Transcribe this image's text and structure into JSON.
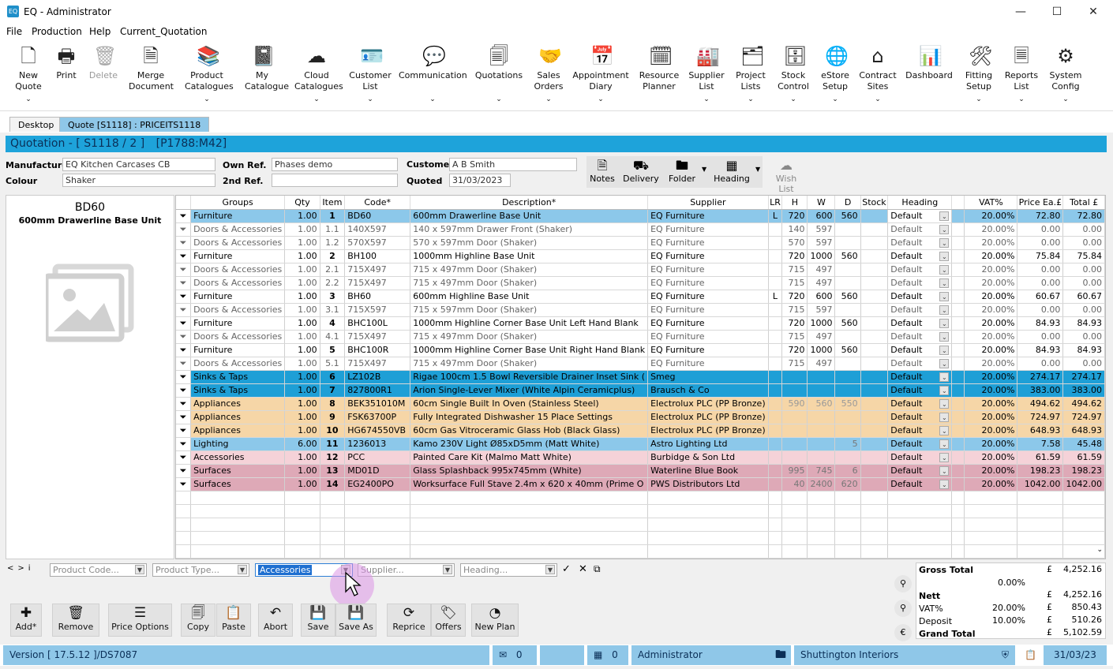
{
  "window": {
    "title": "EQ - Administrator",
    "icon_text": "EQ"
  },
  "menu": [
    "File",
    "Production",
    "Help",
    "Current_Quotation"
  ],
  "ribbon": [
    {
      "label1": "New",
      "label2": "Quote",
      "icon": "new-quote-icon",
      "chev": true,
      "disabled": false
    },
    {
      "label1": "Print",
      "label2": "",
      "icon": "print-icon",
      "chev": false,
      "disabled": false
    },
    {
      "label1": "Delete",
      "label2": "",
      "icon": "delete-icon",
      "chev": false,
      "disabled": true
    },
    {
      "label1": "Merge",
      "label2": "Document",
      "icon": "merge-document-icon",
      "chev": false,
      "disabled": false
    },
    {
      "label1": "Product",
      "label2": "Catalogues",
      "icon": "product-catalogues-icon",
      "chev": true,
      "disabled": false
    },
    {
      "label1": "My",
      "label2": "Catalogue",
      "icon": "my-catalogue-icon",
      "chev": false,
      "disabled": false
    },
    {
      "label1": "Cloud",
      "label2": "Catalogues",
      "icon": "cloud-catalogues-icon",
      "chev": true,
      "disabled": false
    },
    {
      "label1": "Customer",
      "label2": "List",
      "icon": "customer-list-icon",
      "chev": true,
      "disabled": false
    },
    {
      "label1": "Communication",
      "label2": "",
      "icon": "communication-icon",
      "chev": true,
      "disabled": false
    },
    {
      "label1": "Quotations",
      "label2": "",
      "icon": "quotations-icon",
      "chev": true,
      "disabled": false
    },
    {
      "label1": "Sales",
      "label2": "Orders",
      "icon": "sales-orders-icon",
      "chev": true,
      "disabled": false
    },
    {
      "label1": "Appointment",
      "label2": "Diary",
      "icon": "appointment-diary-icon",
      "chev": true,
      "disabled": false
    },
    {
      "label1": "Resource",
      "label2": "Planner",
      "icon": "resource-planner-icon",
      "chev": false,
      "disabled": false
    },
    {
      "label1": "Supplier",
      "label2": "List",
      "icon": "supplier-list-icon",
      "chev": true,
      "disabled": false
    },
    {
      "label1": "Project",
      "label2": "Lists",
      "icon": "project-lists-icon",
      "chev": true,
      "disabled": false
    },
    {
      "label1": "Stock",
      "label2": "Control",
      "icon": "stock-control-icon",
      "chev": true,
      "disabled": false
    },
    {
      "label1": "eStore",
      "label2": "Setup",
      "icon": "estore-setup-icon",
      "chev": true,
      "disabled": false
    },
    {
      "label1": "Contract",
      "label2": "Sites",
      "icon": "contract-sites-icon",
      "chev": true,
      "disabled": false
    },
    {
      "label1": "Dashboard",
      "label2": "",
      "icon": "dashboard-icon",
      "chev": false,
      "disabled": false
    },
    {
      "label1": "Fitting",
      "label2": "Setup",
      "icon": "fitting-setup-icon",
      "chev": true,
      "disabled": false
    },
    {
      "label1": "Reports",
      "label2": "List",
      "icon": "reports-list-icon",
      "chev": true,
      "disabled": false
    },
    {
      "label1": "System",
      "label2": "Config",
      "icon": "system-config-icon",
      "chev": true,
      "disabled": false
    }
  ],
  "tabs": {
    "desktop": "Desktop",
    "quote": "Quote [S1118] : PRICEITS1118"
  },
  "quote_bar": {
    "title": "Quotation - [ S1118 / 2 ]",
    "ref": "[P1788:M42]"
  },
  "header": {
    "manufacturer_label": "Manufacturer",
    "manufacturer": "EQ Kitchen Carcases CB",
    "colour_label": "Colour",
    "colour": "Shaker",
    "own_ref_label": "Own Ref.",
    "own_ref": "Phases demo",
    "second_ref_label": "2nd Ref.",
    "second_ref": "",
    "customer_label": "Customer",
    "customer": "A B Smith",
    "quoted_label": "Quoted",
    "quoted": "31/03/2023"
  },
  "toolbar": {
    "notes": "Notes",
    "delivery": "Delivery",
    "folder": "Folder",
    "heading": "Heading",
    "wish_list": "Wish List"
  },
  "preview": {
    "code": "BD60",
    "name": "600mm Drawerline Base Unit"
  },
  "columns": [
    "Groups",
    "Qty",
    "Item",
    "Code*",
    "Description*",
    "Supplier",
    "LR",
    "H",
    "W",
    "D",
    "Stock",
    "Heading",
    "VAT%",
    "Price Ea.£",
    "Total £"
  ],
  "rows": [
    {
      "group": "Furniture",
      "qty": "1.00",
      "item": "1",
      "code": "BD60",
      "desc": "600mm Drawerline Base Unit",
      "supplier": "EQ Furniture",
      "lr": "L",
      "h": "720",
      "w": "600",
      "d": "560",
      "heading": "Default",
      "vat": "20.00%",
      "price": "72.80",
      "total": "72.80",
      "style": "sel"
    },
    {
      "group": "Doors & Accessories",
      "qty": "1.00",
      "item": "1.1",
      "code": "140X597",
      "desc": "140 x 597mm Drawer Front (Shaker)",
      "supplier": "EQ Furniture",
      "lr": "",
      "h": "140",
      "w": "597",
      "d": "",
      "heading": "Default",
      "vat": "20.00%",
      "price": "0.00",
      "total": "0.00",
      "style": "sub"
    },
    {
      "group": "Doors & Accessories",
      "qty": "1.00",
      "item": "1.2",
      "code": "570X597",
      "desc": "570 x 597mm Door (Shaker)",
      "supplier": "EQ Furniture",
      "lr": "",
      "h": "570",
      "w": "597",
      "d": "",
      "heading": "Default",
      "vat": "20.00%",
      "price": "0.00",
      "total": "0.00",
      "style": "sub"
    },
    {
      "group": "Furniture",
      "qty": "1.00",
      "item": "2",
      "code": "BH100",
      "desc": "1000mm Highline Base Unit",
      "supplier": "EQ Furniture",
      "lr": "",
      "h": "720",
      "w": "1000",
      "d": "560",
      "heading": "Default",
      "vat": "20.00%",
      "price": "75.84",
      "total": "75.84",
      "style": "main"
    },
    {
      "group": "Doors & Accessories",
      "qty": "1.00",
      "item": "2.1",
      "code": "715X497",
      "desc": "715 x 497mm Door (Shaker)",
      "supplier": "EQ Furniture",
      "lr": "",
      "h": "715",
      "w": "497",
      "d": "",
      "heading": "Default",
      "vat": "20.00%",
      "price": "0.00",
      "total": "0.00",
      "style": "sub"
    },
    {
      "group": "Doors & Accessories",
      "qty": "1.00",
      "item": "2.2",
      "code": "715X497",
      "desc": "715 x 497mm Door (Shaker)",
      "supplier": "EQ Furniture",
      "lr": "",
      "h": "715",
      "w": "497",
      "d": "",
      "heading": "Default",
      "vat": "20.00%",
      "price": "0.00",
      "total": "0.00",
      "style": "sub"
    },
    {
      "group": "Furniture",
      "qty": "1.00",
      "item": "3",
      "code": "BH60",
      "desc": "600mm Highline Base Unit",
      "supplier": "EQ Furniture",
      "lr": "L",
      "h": "720",
      "w": "600",
      "d": "560",
      "heading": "Default",
      "vat": "20.00%",
      "price": "60.67",
      "total": "60.67",
      "style": "main"
    },
    {
      "group": "Doors & Accessories",
      "qty": "1.00",
      "item": "3.1",
      "code": "715X597",
      "desc": "715 x 597mm Door (Shaker)",
      "supplier": "EQ Furniture",
      "lr": "",
      "h": "715",
      "w": "597",
      "d": "",
      "heading": "Default",
      "vat": "20.00%",
      "price": "0.00",
      "total": "0.00",
      "style": "sub"
    },
    {
      "group": "Furniture",
      "qty": "1.00",
      "item": "4",
      "code": "BHC100L",
      "desc": "1000mm Highline Corner Base Unit Left Hand Blank",
      "supplier": "EQ Furniture",
      "lr": "",
      "h": "720",
      "w": "1000",
      "d": "560",
      "heading": "Default",
      "vat": "20.00%",
      "price": "84.93",
      "total": "84.93",
      "style": "main"
    },
    {
      "group": "Doors & Accessories",
      "qty": "1.00",
      "item": "4.1",
      "code": "715X497",
      "desc": "715 x 497mm Door (Shaker)",
      "supplier": "EQ Furniture",
      "lr": "",
      "h": "715",
      "w": "497",
      "d": "",
      "heading": "Default",
      "vat": "20.00%",
      "price": "0.00",
      "total": "0.00",
      "style": "sub"
    },
    {
      "group": "Furniture",
      "qty": "1.00",
      "item": "5",
      "code": "BHC100R",
      "desc": "1000mm Highline Corner Base Unit Right Hand Blank",
      "supplier": "EQ Furniture",
      "lr": "",
      "h": "720",
      "w": "1000",
      "d": "560",
      "heading": "Default",
      "vat": "20.00%",
      "price": "84.93",
      "total": "84.93",
      "style": "main"
    },
    {
      "group": "Doors & Accessories",
      "qty": "1.00",
      "item": "5.1",
      "code": "715X497",
      "desc": "715 x 497mm Door (Shaker)",
      "supplier": "EQ Furniture",
      "lr": "",
      "h": "715",
      "w": "497",
      "d": "",
      "heading": "Default",
      "vat": "20.00%",
      "price": "0.00",
      "total": "0.00",
      "style": "sub"
    },
    {
      "group": "Sinks & Taps",
      "qty": "1.00",
      "item": "6",
      "code": "LZ102B",
      "desc": "Rigae 100cm 1.5 Bowl Reversible Drainer Inset Sink (",
      "supplier": "Smeg",
      "lr": "",
      "h": "",
      "w": "",
      "d": "",
      "heading": "Default",
      "vat": "20.00%",
      "price": "274.17",
      "total": "274.17",
      "style": "sink"
    },
    {
      "group": "Sinks & Taps",
      "qty": "1.00",
      "item": "7",
      "code": "827800R1",
      "desc": "Arion Single-Lever Mixer (White Alpin Ceramicplus)",
      "supplier": "Brausch & Co",
      "lr": "",
      "h": "",
      "w": "",
      "d": "",
      "heading": "Default",
      "vat": "20.00%",
      "price": "383.00",
      "total": "383.00",
      "style": "sink"
    },
    {
      "group": "Appliances",
      "qty": "1.00",
      "item": "8",
      "code": "BEK351010M",
      "desc": "60cm Single Built In Oven (Stainless Steel)",
      "supplier": "Electrolux PLC (PP Bronze)",
      "lr": "",
      "h": "590",
      "w": "560",
      "d": "550",
      "heading": "Default",
      "vat": "20.00%",
      "price": "494.62",
      "total": "494.62",
      "style": "app"
    },
    {
      "group": "Appliances",
      "qty": "1.00",
      "item": "9",
      "code": "FSK63700P",
      "desc": "Fully Integrated Dishwasher 15 Place Settings",
      "supplier": "Electrolux PLC (PP Bronze)",
      "lr": "",
      "h": "",
      "w": "",
      "d": "",
      "heading": "Default",
      "vat": "20.00%",
      "price": "724.97",
      "total": "724.97",
      "style": "app"
    },
    {
      "group": "Appliances",
      "qty": "1.00",
      "item": "10",
      "code": "HG674550VB",
      "desc": "60cm Gas Vitroceramic Glass Hob (Black Glass)",
      "supplier": "Electrolux PLC (PP Bronze)",
      "lr": "",
      "h": "",
      "w": "",
      "d": "",
      "heading": "Default",
      "vat": "20.00%",
      "price": "648.93",
      "total": "648.93",
      "style": "app"
    },
    {
      "group": "Lighting",
      "qty": "6.00",
      "item": "11",
      "code": "1236013",
      "desc": "Kamo 230V Light Ø85xD5mm (Matt White)",
      "supplier": "Astro Lighting Ltd",
      "lr": "",
      "h": "",
      "w": "",
      "d": "5",
      "heading": "Default",
      "vat": "20.00%",
      "price": "7.58",
      "total": "45.48",
      "style": "light"
    },
    {
      "group": "Accessories",
      "qty": "1.00",
      "item": "12",
      "code": "PCC",
      "desc": "Painted Care Kit (Malmo Matt White)",
      "supplier": "Burbidge & Son Ltd",
      "lr": "",
      "h": "",
      "w": "",
      "d": "",
      "heading": "Default",
      "vat": "20.00%",
      "price": "61.59",
      "total": "61.59",
      "style": "acc"
    },
    {
      "group": "Surfaces",
      "qty": "1.00",
      "item": "13",
      "code": "MD01D",
      "desc": "Glass Splashback 995x745mm (White)",
      "supplier": "Waterline Blue Book",
      "lr": "",
      "h": "995",
      "w": "745",
      "d": "6",
      "heading": "Default",
      "vat": "20.00%",
      "price": "198.23",
      "total": "198.23",
      "style": "surf"
    },
    {
      "group": "Surfaces",
      "qty": "1.00",
      "item": "14",
      "code": "EG2400PO",
      "desc": "Worksurface Full Stave 2.4m x 620 x 40mm (Prime O",
      "supplier": "PWS Distributors Ltd",
      "lr": "",
      "h": "40",
      "w": "2400",
      "d": "620",
      "heading": "Default",
      "vat": "20.00%",
      "price": "1042.00",
      "total": "1042.00",
      "style": "surf"
    }
  ],
  "filters": {
    "product_code": "Product Code...",
    "product_type": "Product Type...",
    "group": "Accessories",
    "supplier": "Supplier...",
    "heading": "Heading..."
  },
  "bottom_buttons": [
    {
      "label": "Add*",
      "icon": "add-icon"
    },
    {
      "label": "Remove",
      "icon": "remove-icon"
    },
    {
      "label": "Price Options",
      "icon": "price-options-icon"
    },
    {
      "label": "Copy",
      "icon": "copy-icon"
    },
    {
      "label": "Paste",
      "icon": "paste-icon"
    },
    {
      "label": "Abort",
      "icon": "abort-icon"
    },
    {
      "label": "Save",
      "icon": "save-icon"
    },
    {
      "label": "Save As",
      "icon": "save-as-icon"
    },
    {
      "label": "Reprice",
      "icon": "reprice-icon"
    },
    {
      "label": "Offers",
      "icon": "offers-icon"
    },
    {
      "label": "New Plan",
      "icon": "new-plan-icon"
    }
  ],
  "totals": {
    "gross_label": "Gross Total",
    "gross": "4,252.16",
    "discount_pct": "0.00%",
    "nett_label": "Nett",
    "nett": "4,252.16",
    "vat_label": "VAT%",
    "vat_pct": "20.00%",
    "vat": "850.43",
    "deposit_label": "Deposit",
    "deposit_pct": "10.00%",
    "deposit": "510.26",
    "grand_label": "Grand Total",
    "grand": "5,102.59",
    "currency": "£"
  },
  "status": {
    "version": "Version [ 17.5.12 ]/DS7087",
    "mail_count": "0",
    "doc_count": "0",
    "user": "Administrator",
    "company": "Shuttington Interiors",
    "date": "31/03/23"
  },
  "colors": {
    "accent": "#1ea3da",
    "sel": "#8cc8ea",
    "sink": "#1e9fd6",
    "app": "#f6d6a7",
    "light": "#8cc8ea",
    "acc": "#f5d2d8",
    "surf": "#dea9b7"
  }
}
